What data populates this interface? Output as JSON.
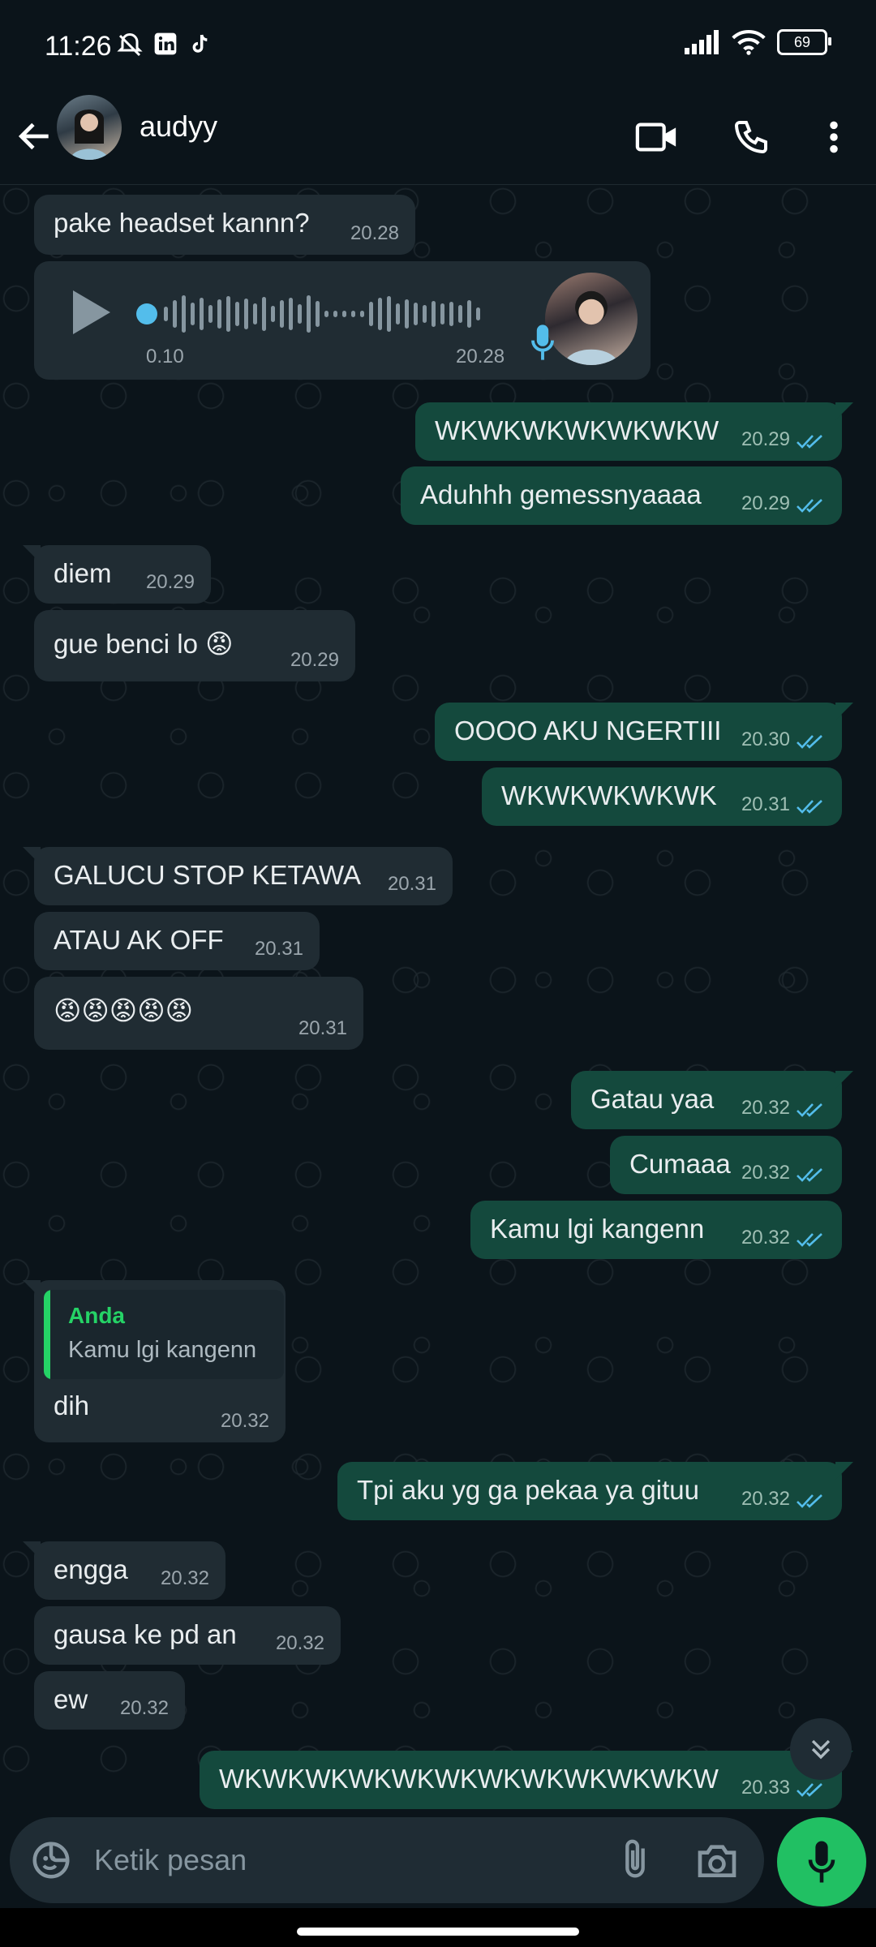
{
  "status_bar": {
    "time": "11:26",
    "battery": "69"
  },
  "header": {
    "contact_name": "audyy"
  },
  "voice_note": {
    "elapsed": "0.10",
    "time": "20.28"
  },
  "messages": [
    {
      "dir": "in",
      "text": "pake headset kannn?",
      "time": "20.28"
    },
    {
      "dir": "out",
      "text": "WKWKWKWKWKWKW",
      "time": "20.29"
    },
    {
      "dir": "out",
      "text": "Aduhhh gemessnyaaaa",
      "time": "20.29"
    },
    {
      "dir": "in",
      "text": "diem",
      "time": "20.29"
    },
    {
      "dir": "in",
      "text": "gue benci lo 😡",
      "time": "20.29"
    },
    {
      "dir": "out",
      "text": "OOOO AKU NGERTIII",
      "time": "20.30"
    },
    {
      "dir": "out",
      "text": "WKWKWKWKWK",
      "time": "20.31"
    },
    {
      "dir": "in",
      "text": "GALUCU STOP KETAWA",
      "time": "20.31"
    },
    {
      "dir": "in",
      "text": "ATAU AK OFF",
      "time": "20.31"
    },
    {
      "dir": "in",
      "text": "😡😡😡😡😡",
      "time": "20.31"
    },
    {
      "dir": "out",
      "text": "Gatau yaa",
      "time": "20.32"
    },
    {
      "dir": "out",
      "text": "Cumaaa",
      "time": "20.32"
    },
    {
      "dir": "out",
      "text": "Kamu lgi kangenn",
      "time": "20.32"
    },
    {
      "dir": "in",
      "text": "dih",
      "time": "20.32",
      "quote_name": "Anda",
      "quote_text": "Kamu lgi kangenn"
    },
    {
      "dir": "out",
      "text": "Tpi aku yg ga pekaa ya gituu",
      "time": "20.32"
    },
    {
      "dir": "in",
      "text": "engga",
      "time": "20.32"
    },
    {
      "dir": "in",
      "text": "gausa ke pd an",
      "time": "20.32"
    },
    {
      "dir": "in",
      "text": "ew",
      "time": "20.32"
    },
    {
      "dir": "out",
      "text": "WKWKWKWKWKWKWKWKWKWKWKW",
      "time": "20.33"
    }
  ],
  "input": {
    "placeholder": "Ketik pesan"
  },
  "colors": {
    "incoming": "#202c33",
    "outgoing": "#14493d",
    "read_ticks": "#53bdeb",
    "accent": "#21c063"
  }
}
